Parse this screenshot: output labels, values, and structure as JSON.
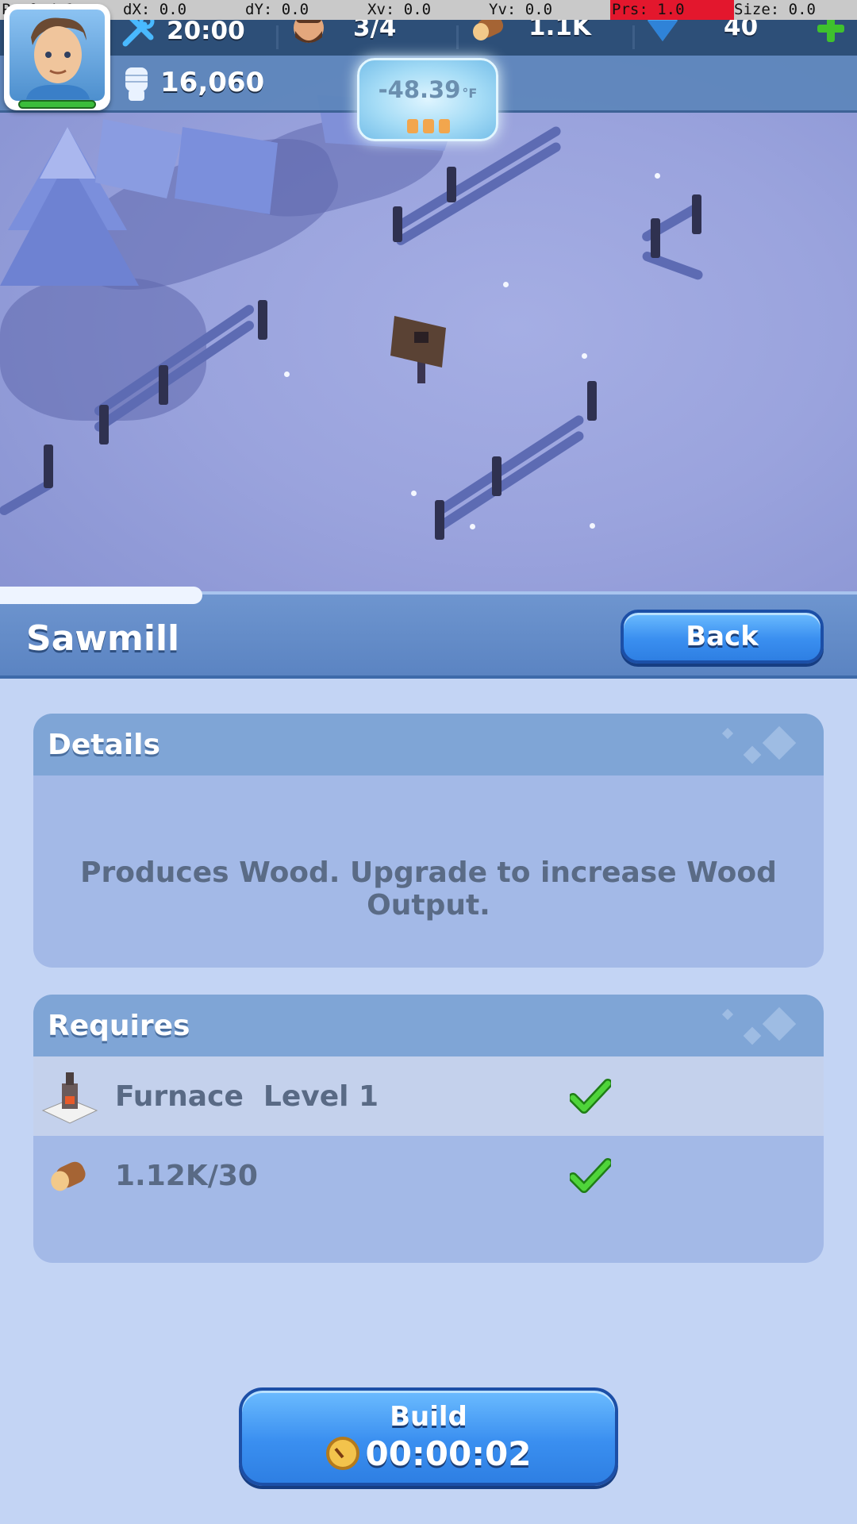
{
  "debug": {
    "pointer": "P: 0 / 1",
    "dx": "dX: 0.0",
    "dy": "dY: 0.0",
    "xv": "Xv: 0.0",
    "yv": "Yv: 0.0",
    "prs": "Prs: 1.0",
    "size": "Size: 0.0"
  },
  "hud": {
    "builders_timer": "20:00",
    "workers": "3/4",
    "wood": "1.1K",
    "gems": "40",
    "power": "16,060",
    "temperature": "-48.39",
    "temperature_unit": "°F"
  },
  "building": {
    "title": "Sawmill",
    "back_label": "Back"
  },
  "details": {
    "heading": "Details",
    "description": "Produces Wood. Upgrade to increase Wood Output."
  },
  "requires": {
    "heading": "Requires",
    "items": [
      {
        "label": "Furnace  Level 1",
        "icon": "furnace-icon",
        "met": true
      },
      {
        "label": "1.12K/30",
        "icon": "wood-icon",
        "met": true
      }
    ]
  },
  "build": {
    "label": "Build",
    "time": "00:00:02"
  },
  "colors": {
    "accent_blue": "#3a8ff0",
    "panel_bg": "#a3b9e7",
    "panel_header": "#7fa5d6",
    "check_green": "#3fc12d",
    "debug_prs_red": "#e3172d"
  }
}
